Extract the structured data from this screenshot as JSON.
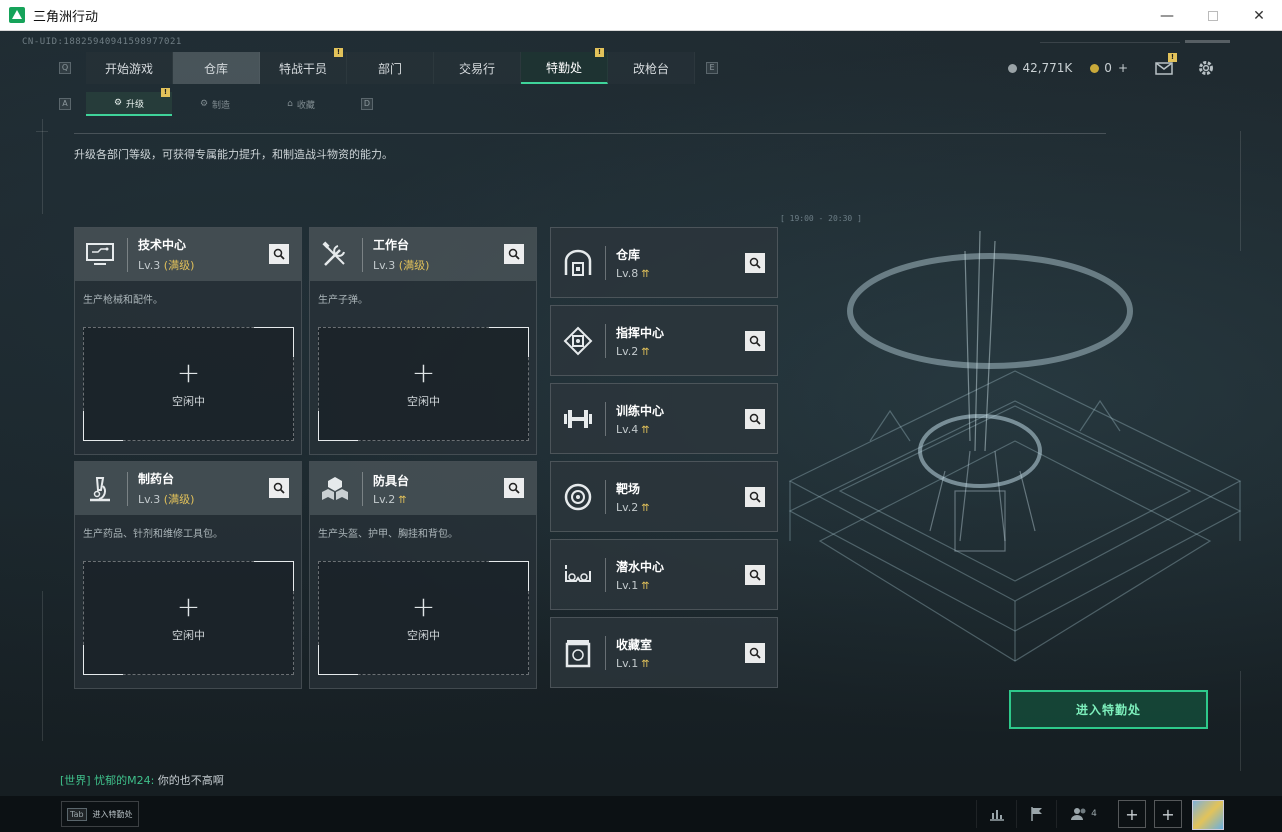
{
  "window": {
    "title": "三角洲行动",
    "min": "—",
    "close": "✕"
  },
  "uid": "CN-UID:18825940941598977021",
  "topnav": {
    "key_left": "Q",
    "key_right": "E",
    "tabs": [
      {
        "label": "开始游戏",
        "badge": ""
      },
      {
        "label": "仓库",
        "badge": ""
      },
      {
        "label": "特战干员",
        "badge": "!"
      },
      {
        "label": "部门",
        "badge": ""
      },
      {
        "label": "交易行",
        "badge": ""
      },
      {
        "label": "特勤处",
        "badge": "!"
      },
      {
        "label": "改枪台",
        "badge": ""
      }
    ]
  },
  "currency": {
    "silver": "42,771K",
    "gold": "0",
    "plus": "+"
  },
  "mail_badge": "!",
  "subnav": {
    "key_left": "A",
    "key_right": "D",
    "tabs": [
      {
        "label": "升级",
        "badge": "!"
      },
      {
        "label": "制造"
      },
      {
        "label": "收藏"
      }
    ]
  },
  "description": "升级各部门等级，可获得专属能力提升，和制造战斗物资的能力。",
  "production_cards": [
    {
      "name": "技术中心",
      "level": "Lv.3",
      "level_note": "(满级)",
      "desc": "生产枪械和配件。",
      "plus": "+",
      "status": "空闲中"
    },
    {
      "name": "工作台",
      "level": "Lv.3",
      "level_note": "(满级)",
      "desc": "生产子弹。",
      "plus": "+",
      "status": "空闲中"
    },
    {
      "name": "制药台",
      "level": "Lv.3",
      "level_note": "(满级)",
      "desc": "生产药品、针剂和维修工具包。",
      "plus": "+",
      "status": "空闲中"
    },
    {
      "name": "防具台",
      "level": "Lv.2",
      "level_note": "",
      "desc": "生产头盔、护甲、胸挂和背包。",
      "plus": "+",
      "status": "空闲中"
    }
  ],
  "facility_cards": [
    {
      "name": "仓库",
      "level": "Lv.8"
    },
    {
      "name": "指挥中心",
      "level": "Lv.2"
    },
    {
      "name": "训练中心",
      "level": "Lv.4"
    },
    {
      "name": "靶场",
      "level": "Lv.2"
    },
    {
      "name": "潜水中心",
      "level": "Lv.1"
    },
    {
      "name": "收藏室",
      "level": "Lv.1"
    }
  ],
  "scene_timestamp": "[ 19:00 - 20:30 ]",
  "enter_button": "进入特勤处",
  "chat": {
    "channel": "[世界]",
    "sender": "忧郁的M24:",
    "message": "你的也不高啊"
  },
  "bottom": {
    "tab_key": "Tab",
    "tab_label": "进入特勤处",
    "team_count": "4",
    "plus": "+"
  },
  "colors": {
    "accent": "#3fd39a",
    "gold": "#e0c05a",
    "bg": "#1a2328"
  }
}
